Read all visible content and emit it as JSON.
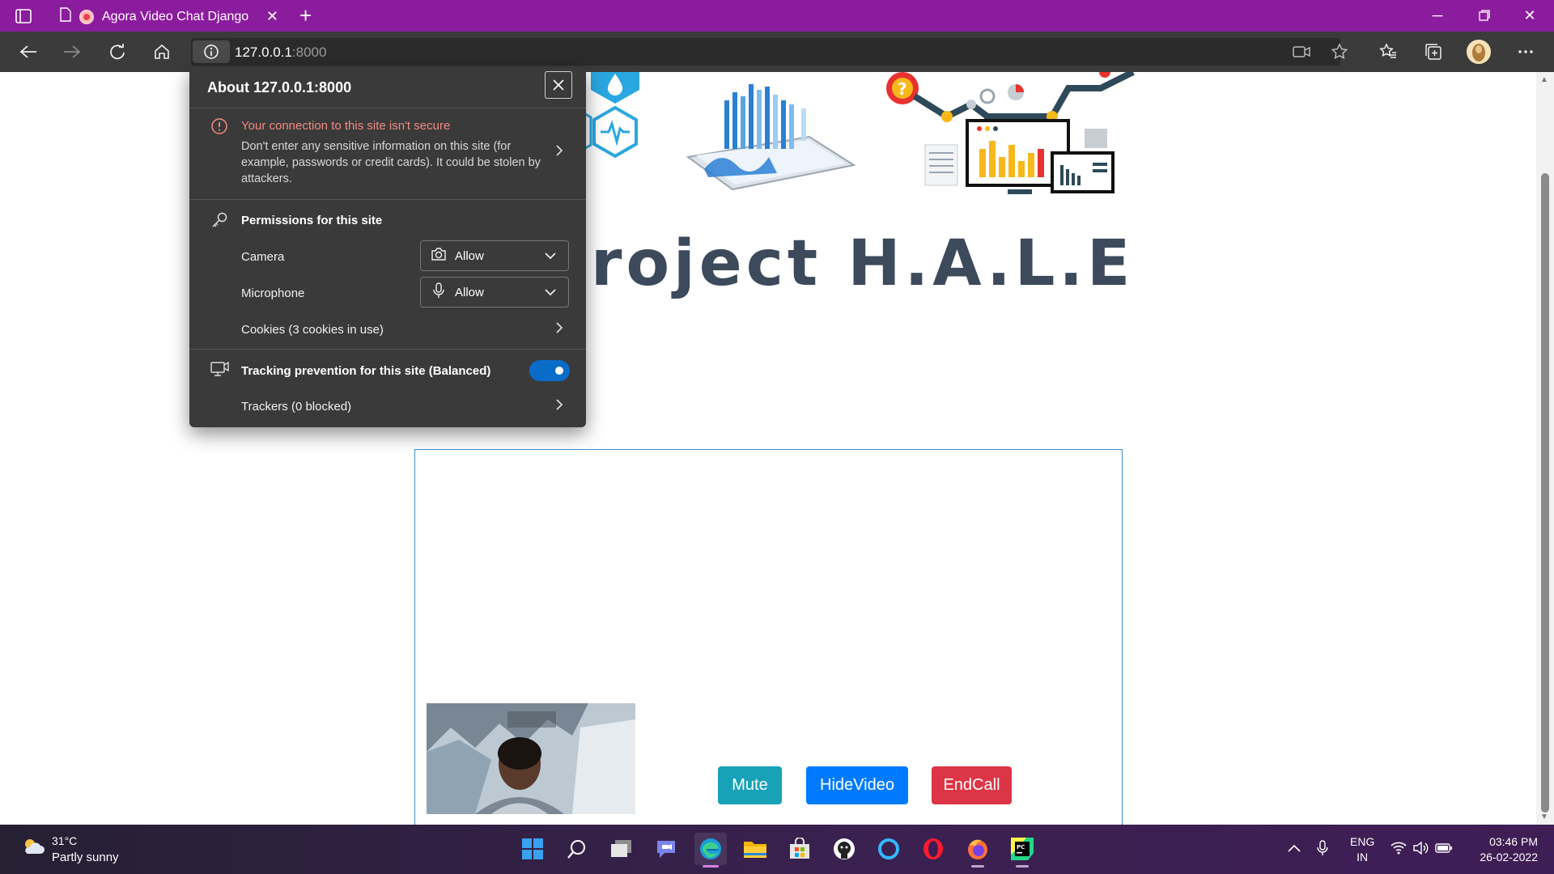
{
  "browser": {
    "tab_title": "Agora Video Chat Django",
    "address": {
      "host": "127.0.0.1",
      "port": ":8000"
    }
  },
  "page": {
    "project_title": "roject H.A.L.E",
    "buttons": {
      "mute": "Mute",
      "hide_video": "HideVideo",
      "end_call": "EndCall"
    }
  },
  "site_info": {
    "title": "About 127.0.0.1:8000",
    "warning_title": "Your connection to this site isn't secure",
    "warning_body": "Don't enter any sensitive information on this site (for example, passwords or credit cards). It could be stolen by attackers.",
    "permissions_title": "Permissions for this site",
    "camera_label": "Camera",
    "camera_value": "Allow",
    "microphone_label": "Microphone",
    "microphone_value": "Allow",
    "cookies_label": "Cookies (3 cookies in use)",
    "tracking_label": "Tracking prevention for this site (Balanced)",
    "tracking_enabled": true,
    "trackers_label": "Trackers (0 blocked)"
  },
  "taskbar": {
    "weather_temp": "31°C",
    "weather_desc": "Partly sunny",
    "lang_top": "ENG",
    "lang_bottom": "IN",
    "time": "03:46 PM",
    "date": "26-02-2022",
    "apps": [
      "start-icon",
      "search-icon",
      "task-view-icon",
      "teams-chat-icon",
      "edge-icon",
      "file-explorer-icon",
      "microsoft-store-icon",
      "github-icon",
      "cortana-icon",
      "opera-icon",
      "firefox-icon",
      "pycharm-icon"
    ]
  },
  "colors": {
    "tab_bar": "#8c1c9e",
    "mute_button": "#17a2b8",
    "hide_video_button": "#007bff",
    "end_call_button": "#dc3545",
    "toggle_on": "#0a6cc9"
  }
}
